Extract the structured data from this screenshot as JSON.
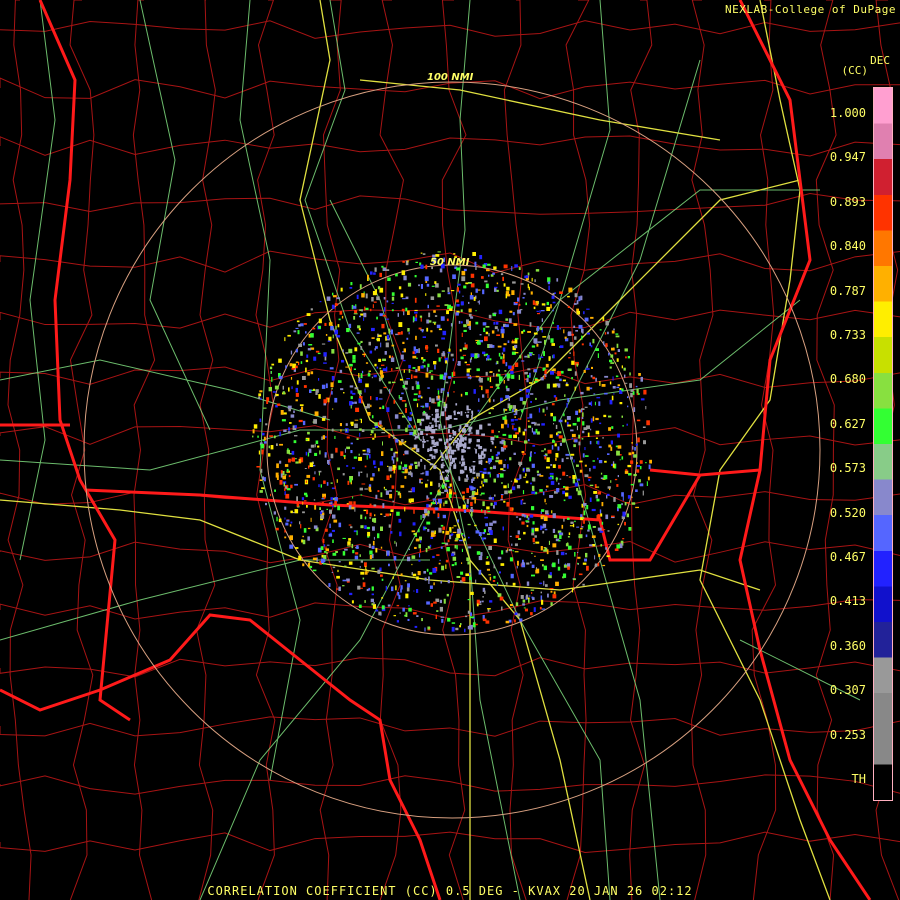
{
  "header": {
    "credit": "NEXLAB-College of DuPage"
  },
  "legend": {
    "unit_top": "DEC",
    "unit_label": "(CC)",
    "ticks": [
      "1.000",
      "0.947",
      "0.893",
      "0.840",
      "0.787",
      "0.733",
      "0.680",
      "0.627",
      "0.573",
      "0.520",
      "0.467",
      "0.413",
      "0.360",
      "0.307",
      "0.253",
      "TH"
    ],
    "bar_colors": [
      "#ff9fd0",
      "#e080b0",
      "#d02030",
      "#ff3300",
      "#ff7700",
      "#ffb000",
      "#ffee00",
      "#c8e000",
      "#88e040",
      "#33ff33",
      "#88cc88",
      "#8888cc",
      "#5566ff",
      "#2222ff",
      "#1111cc",
      "#222299",
      "#999999",
      "#888888",
      "#888888",
      "#000000"
    ]
  },
  "rings": {
    "inner": "50 NMI",
    "outer": "100 NMI"
  },
  "footer": {
    "caption": "CORRELATION COEFFICIENT (CC) 0.5 DEG - KVAX 20 JAN 26 02:12"
  },
  "colors": {
    "state_border": "#ff2020",
    "county": "#b01818",
    "roads": "#88ee88",
    "highway": "#eeee44",
    "ring": "#ddaa88",
    "text": "#ffff66"
  }
}
